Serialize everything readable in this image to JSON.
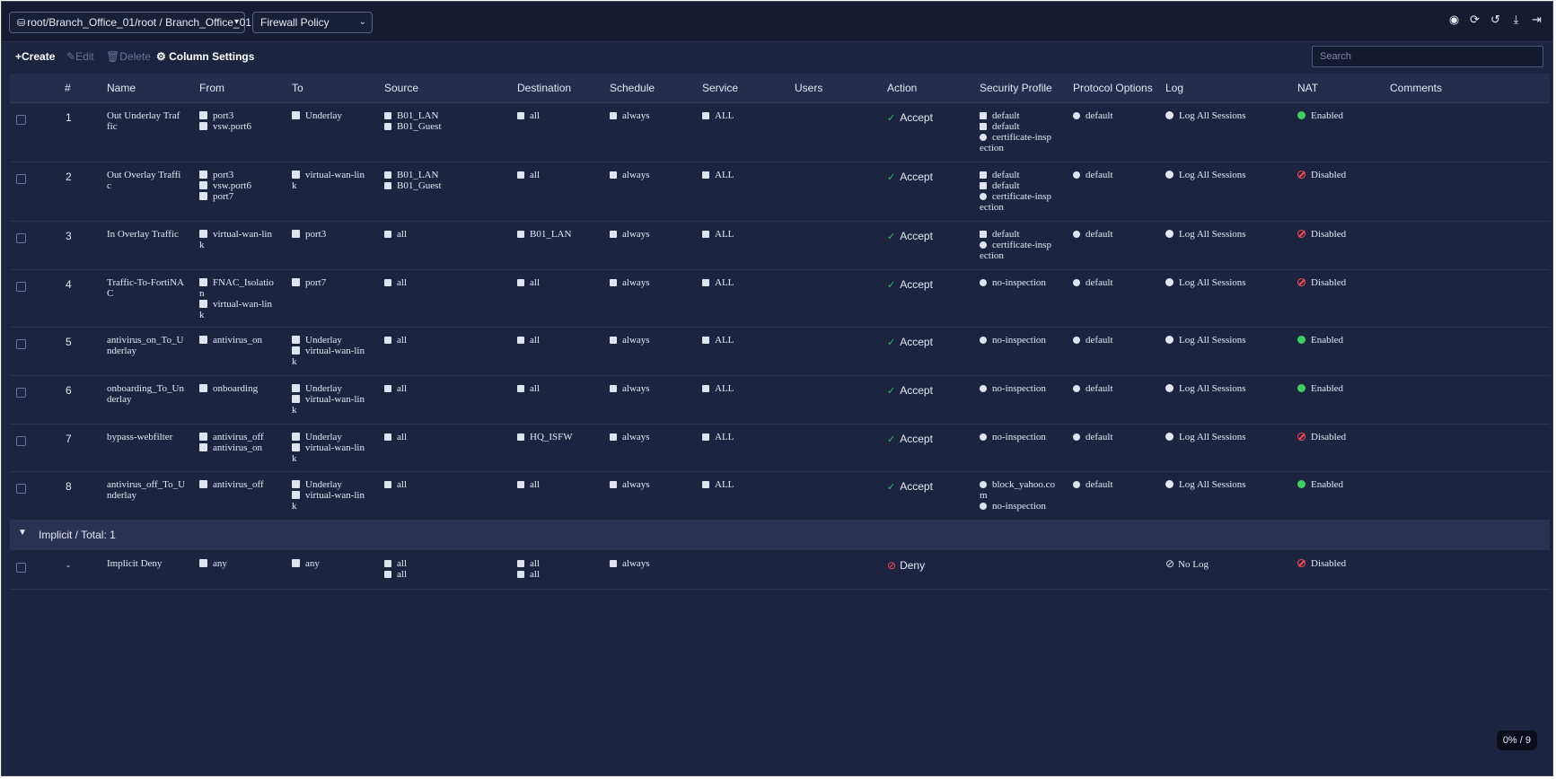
{
  "topbar": {
    "scope_label": "root/Branch_Office_01/root / Branch_Office_01",
    "policy_label": "Firewall Policy",
    "icons": [
      "eye-icon",
      "refresh-icon",
      "history-icon",
      "download-icon",
      "export-icon"
    ]
  },
  "toolbar": {
    "create": "Create",
    "edit": "Edit",
    "delete": "Delete",
    "column_settings": "Column Settings",
    "search_placeholder": "Search"
  },
  "columns": [
    "#",
    "Name",
    "From",
    "To",
    "Source",
    "Destination",
    "Schedule",
    "Service",
    "Users",
    "Action",
    "Security Profile",
    "Protocol Options",
    "Log",
    "NAT",
    "Comments"
  ],
  "rows": [
    {
      "id": "1",
      "name": [
        "Out Underlay Traf",
        "fic"
      ],
      "from": [
        "port3",
        "vsw.port6"
      ],
      "to": [
        "Underlay"
      ],
      "source": [
        "B01_LAN",
        "B01_Guest"
      ],
      "destination": [
        "all"
      ],
      "schedule": "always",
      "service": "ALL",
      "action": "Accept",
      "security": [
        "default",
        "default",
        "certificate-insp",
        "ection"
      ],
      "protocol": "default",
      "log": "Log All Sessions",
      "nat": "Enabled"
    },
    {
      "id": "2",
      "name": [
        "Out Overlay Traffi",
        "c"
      ],
      "from": [
        "port3",
        "vsw.port6",
        "port7"
      ],
      "to": [
        "virtual-wan-lin",
        "k"
      ],
      "source": [
        "B01_LAN",
        "B01_Guest"
      ],
      "destination": [
        "all"
      ],
      "schedule": "always",
      "service": "ALL",
      "action": "Accept",
      "security": [
        "default",
        "default",
        "certificate-insp",
        "ection"
      ],
      "protocol": "default",
      "log": "Log All Sessions",
      "nat": "Disabled"
    },
    {
      "id": "3",
      "name": [
        "In Overlay Traffic"
      ],
      "from": [
        "virtual-wan-lin",
        "k"
      ],
      "to": [
        "port3"
      ],
      "source": [
        "all"
      ],
      "destination": [
        "B01_LAN"
      ],
      "schedule": "always",
      "service": "ALL",
      "action": "Accept",
      "security": [
        "default",
        "certificate-insp",
        "ection"
      ],
      "protocol": "default",
      "log": "Log All Sessions",
      "nat": "Disabled"
    },
    {
      "id": "4",
      "name": [
        "Traffic-To-FortiNA",
        "C"
      ],
      "from": [
        "FNAC_Isolatio",
        "n",
        "virtual-wan-lin",
        "k"
      ],
      "to": [
        "port7"
      ],
      "source": [
        "all"
      ],
      "destination": [
        "all"
      ],
      "schedule": "always",
      "service": "ALL",
      "action": "Accept",
      "security": [
        "no-inspection"
      ],
      "protocol": "default",
      "log": "Log All Sessions",
      "nat": "Disabled"
    },
    {
      "id": "5",
      "name": [
        "antivirus_on_To_U",
        "nderlay"
      ],
      "from": [
        "antivirus_on"
      ],
      "to": [
        "Underlay",
        "virtual-wan-lin",
        "k"
      ],
      "source": [
        "all"
      ],
      "destination": [
        "all"
      ],
      "schedule": "always",
      "service": "ALL",
      "action": "Accept",
      "security": [
        "no-inspection"
      ],
      "protocol": "default",
      "log": "Log All Sessions",
      "nat": "Enabled"
    },
    {
      "id": "6",
      "name": [
        "onboarding_To_Un",
        "derlay"
      ],
      "from": [
        "onboarding"
      ],
      "to": [
        "Underlay",
        "virtual-wan-lin",
        "k"
      ],
      "source": [
        "all"
      ],
      "destination": [
        "all"
      ],
      "schedule": "always",
      "service": "ALL",
      "action": "Accept",
      "security": [
        "no-inspection"
      ],
      "protocol": "default",
      "log": "Log All Sessions",
      "nat": "Enabled"
    },
    {
      "id": "7",
      "name": [
        "bypass-webfilter"
      ],
      "from": [
        "antivirus_off",
        "antivirus_on"
      ],
      "to": [
        "Underlay",
        "virtual-wan-lin",
        "k"
      ],
      "source": [
        "all"
      ],
      "destination": [
        "HQ_ISFW"
      ],
      "schedule": "always",
      "service": "ALL",
      "action": "Accept",
      "security": [
        "no-inspection"
      ],
      "protocol": "default",
      "log": "Log All Sessions",
      "nat": "Disabled"
    },
    {
      "id": "8",
      "name": [
        "antivirus_off_To_U",
        "nderlay"
      ],
      "from": [
        "antivirus_off"
      ],
      "to": [
        "Underlay",
        "virtual-wan-lin",
        "k"
      ],
      "source": [
        "all"
      ],
      "destination": [
        "all"
      ],
      "schedule": "always",
      "service": "ALL",
      "action": "Accept",
      "security": [
        "block_yahoo.co",
        "m",
        "no-inspection"
      ],
      "protocol": "default",
      "log": "Log All Sessions",
      "nat": "Enabled"
    }
  ],
  "group": {
    "label": "Implicit / Total: 1"
  },
  "implicit_row": {
    "id": "-",
    "name": "Implicit Deny",
    "from": "any",
    "to": "any",
    "source": [
      "all",
      "all"
    ],
    "destination": [
      "all",
      "all"
    ],
    "schedule": "always",
    "action": "Deny",
    "log": "No Log",
    "nat": "Disabled"
  },
  "footer": {
    "counter": "0% / 9"
  },
  "colors": {
    "background": "#1d2440",
    "header": "#262d4c",
    "accept": "#36c36a",
    "deny": "#ff4b55",
    "enabled": "#3fcf5e"
  }
}
